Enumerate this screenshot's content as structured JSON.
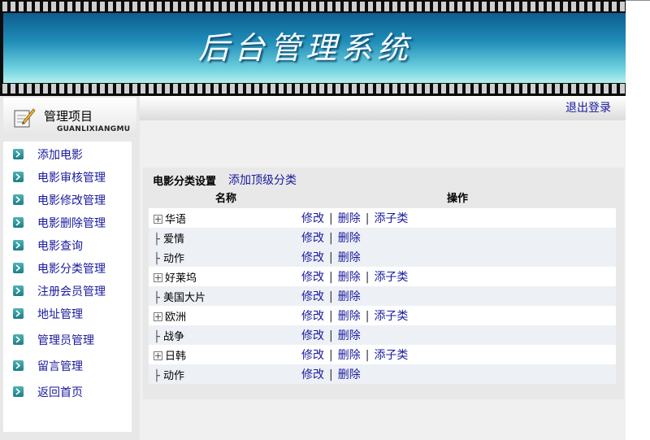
{
  "banner": {
    "title": "后台管理系统"
  },
  "sidebar": {
    "header_title": "管理项目",
    "header_sub": "GUANLIXIANGMU",
    "items": [
      {
        "label": "添加电影"
      },
      {
        "label": "电影审核管理"
      },
      {
        "label": "电影修改管理"
      },
      {
        "label": "电影删除管理"
      },
      {
        "label": "电影查询"
      },
      {
        "label": "电影分类管理"
      },
      {
        "label": "注册会员管理"
      },
      {
        "label": "地址管理"
      },
      {
        "label": "管理员管理"
      },
      {
        "label": "留言管理"
      },
      {
        "label": "返回首页"
      }
    ]
  },
  "topbar": {
    "logout": "退出登录"
  },
  "panel": {
    "title": "电影分类设置",
    "add_top": "添加顶级分类",
    "col_name": "名称",
    "col_ops": "操作",
    "op_edit": "修改",
    "op_delete": "删除",
    "op_add_child": "添子类",
    "rows": [
      {
        "name": "华语",
        "level": "parent"
      },
      {
        "name": "爱情",
        "level": "child"
      },
      {
        "name": "动作",
        "level": "child"
      },
      {
        "name": "好莱坞",
        "level": "parent"
      },
      {
        "name": "美国大片",
        "level": "child"
      },
      {
        "name": "欧洲",
        "level": "parent"
      },
      {
        "name": "战争",
        "level": "child"
      },
      {
        "name": "日韩",
        "level": "parent"
      },
      {
        "name": "动作",
        "level": "child"
      }
    ]
  },
  "colors": {
    "link": "#1a1a9e",
    "banner_sky": "#1f8cb8",
    "menu_icon": "#1c7d86"
  }
}
